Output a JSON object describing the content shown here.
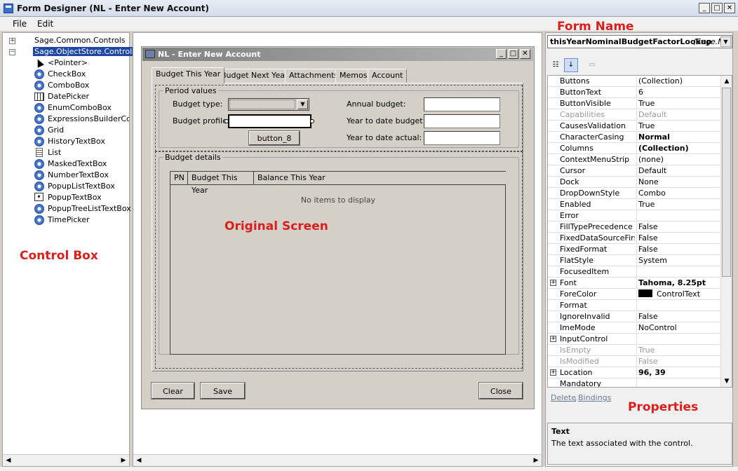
{
  "window": {
    "title": "Form Designer (NL - Enter New Account)",
    "min_label": "_",
    "max_label": "□",
    "close_label": "✕"
  },
  "menu": {
    "file": "File",
    "edit": "Edit"
  },
  "annotations": {
    "control_box": "Control Box",
    "original_screen": "Original Screen",
    "form_name": "Form Name",
    "properties": "Properties"
  },
  "control_box": {
    "groups": [
      {
        "label": "Sage.Common.Controls",
        "expander": "+"
      },
      {
        "label": "Sage.ObjectStore.Controls",
        "expander": "−"
      }
    ],
    "items": [
      {
        "label": "<Pointer>",
        "icon": "pointer-icon"
      },
      {
        "label": "CheckBox",
        "icon": "gear-icon"
      },
      {
        "label": "ComboBox",
        "icon": "gear-icon"
      },
      {
        "label": "DatePicker",
        "icon": "grid-icon"
      },
      {
        "label": "EnumComboBox",
        "icon": "gear-icon"
      },
      {
        "label": "ExpressionsBuilderControl",
        "icon": "gear-icon"
      },
      {
        "label": "Grid",
        "icon": "gear-icon"
      },
      {
        "label": "HistoryTextBox",
        "icon": "gear-icon"
      },
      {
        "label": "List",
        "icon": "list-icon"
      },
      {
        "label": "MaskedTextBox",
        "icon": "gear-icon"
      },
      {
        "label": "NumberTextBox",
        "icon": "gear-icon"
      },
      {
        "label": "PopupListTextBox",
        "icon": "gear-icon"
      },
      {
        "label": "PopupTextBox",
        "icon": "popup-icon"
      },
      {
        "label": "PopupTreeListTextBox",
        "icon": "gear-icon"
      },
      {
        "label": "TimePicker",
        "icon": "gear-icon"
      }
    ]
  },
  "form": {
    "title": "NL - Enter New Account",
    "tabs": [
      "Budget This Year",
      "Budget Next Year",
      "Attachments",
      "Memos",
      "Account"
    ],
    "period_group": "Period values",
    "budget_type_label": "Budget type:",
    "budget_profile_label": "Budget profile:",
    "annual_budget_label": "Annual budget:",
    "ytd_budget_label": "Year to date budget:",
    "ytd_actual_label": "Year to date actual:",
    "button_8": "button_8",
    "details_group": "Budget details",
    "columns": [
      "PN",
      "Budget This Year",
      "Balance This Year"
    ],
    "empty_message": "No items to display",
    "clear": "Clear",
    "save": "Save",
    "close": "Close"
  },
  "properties": {
    "selected_object": "thisYearNominalBudgetFactorLookup",
    "selected_type": "(Sage.M",
    "rows": [
      {
        "name": "Buttons",
        "value": "(Collection)"
      },
      {
        "name": "ButtonText",
        "value": "6"
      },
      {
        "name": "ButtonVisible",
        "value": "True"
      },
      {
        "name": "Capabilities",
        "value": "Default",
        "disabled": true
      },
      {
        "name": "CausesValidation",
        "value": "True"
      },
      {
        "name": "CharacterCasing",
        "value": "Normal",
        "bold": true
      },
      {
        "name": "Columns",
        "value": "(Collection)",
        "bold": true
      },
      {
        "name": "ContextMenuStrip",
        "value": "(none)"
      },
      {
        "name": "Cursor",
        "value": "Default"
      },
      {
        "name": "Dock",
        "value": "None"
      },
      {
        "name": "DropDownStyle",
        "value": "Combo"
      },
      {
        "name": "Enabled",
        "value": "True"
      },
      {
        "name": "Error",
        "value": ""
      },
      {
        "name": "FillTypePrecedence",
        "value": "False"
      },
      {
        "name": "FixedDataSourceFirst",
        "value": "False"
      },
      {
        "name": "FixedFormat",
        "value": "False"
      },
      {
        "name": "FlatStyle",
        "value": "System"
      },
      {
        "name": "FocusedItem",
        "value": ""
      },
      {
        "name": "Font",
        "value": "Tahoma, 8.25pt",
        "bold": true,
        "expandable": true
      },
      {
        "name": "ForeColor",
        "value": "ControlText",
        "swatch": "#000000"
      },
      {
        "name": "Format",
        "value": ""
      },
      {
        "name": "IgnoreInvalid",
        "value": "False"
      },
      {
        "name": "ImeMode",
        "value": "NoControl"
      },
      {
        "name": "InputControl",
        "value": "",
        "expandable": true
      },
      {
        "name": "IsEmpty",
        "value": "True",
        "disabled": true
      },
      {
        "name": "IsModified",
        "value": "False",
        "disabled": true
      },
      {
        "name": "Location",
        "value": "96, 39",
        "bold": true,
        "expandable": true
      },
      {
        "name": "Mandatory",
        "value": ""
      }
    ],
    "delete_link": "Delete",
    "bindings_link": "Bindings",
    "desc_title": "Text",
    "desc_text": "The text associated with the control."
  },
  "colors": {
    "annotation": "#d91e1e",
    "selection": "#1d46a5"
  }
}
